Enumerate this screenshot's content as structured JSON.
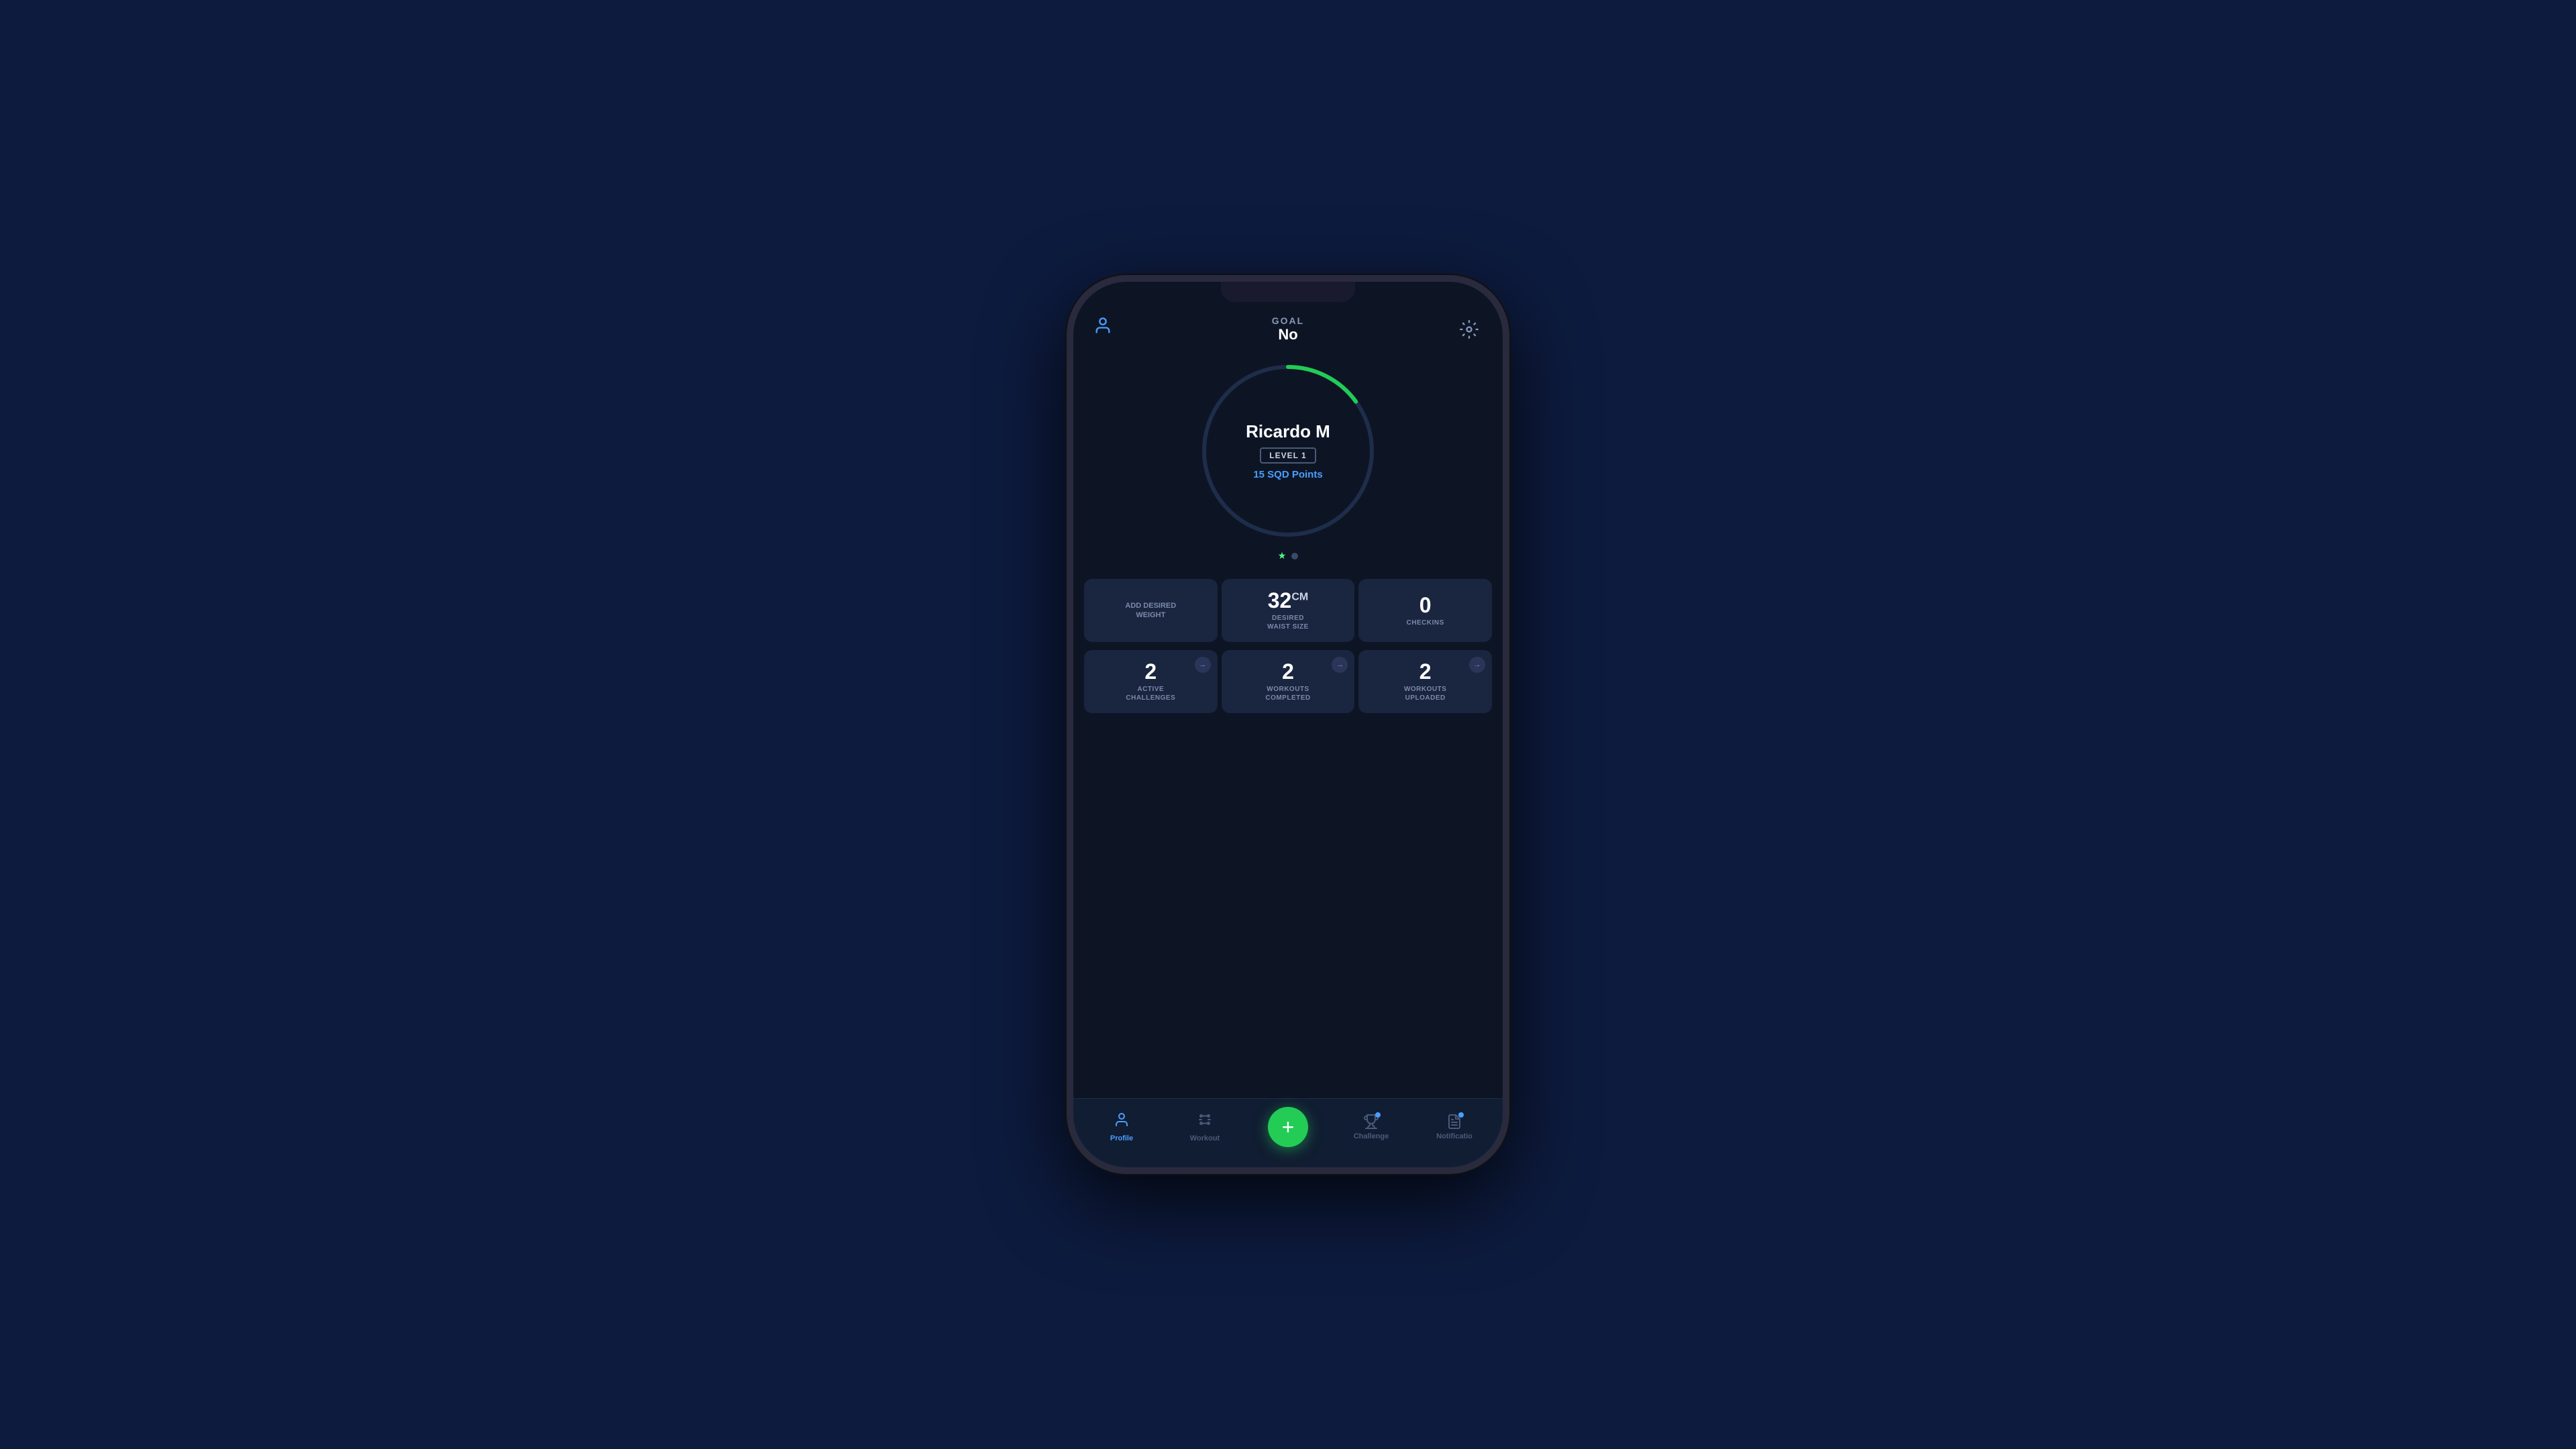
{
  "background": "#0d1b3e",
  "header": {
    "goal_label": "GOAL",
    "goal_value": "No",
    "left_icon": "user-icon",
    "right_icon": "settings-icon"
  },
  "profile": {
    "name": "Ricardo M",
    "level": "LEVEL 1",
    "points_label": "SQD Points",
    "points_value": "15",
    "circle_progress": 15
  },
  "stats_row1": [
    {
      "id": "add-weight",
      "label": "ADD DESIRED\nWEIGHT",
      "value": null,
      "has_arrow": false
    },
    {
      "id": "waist-size",
      "label": "DESIRED\nWAIST SIZE",
      "value": "32",
      "unit": "CM",
      "has_arrow": false
    },
    {
      "id": "checkins",
      "label": "CHECKINS",
      "value": "0",
      "has_arrow": false
    }
  ],
  "stats_row2": [
    {
      "id": "active-challenges",
      "label": "ACTIVE\nCHALLENGES",
      "value": "2",
      "has_arrow": true
    },
    {
      "id": "workouts-completed",
      "label": "WORKOUTS\nCOMPLETED",
      "value": "2",
      "has_arrow": true
    },
    {
      "id": "workouts-uploaded",
      "label": "WORKOUTS\nUPLOADED",
      "value": "2",
      "has_arrow": true
    }
  ],
  "nav": {
    "items": [
      {
        "id": "profile",
        "label": "Profile",
        "icon": "👤",
        "active": true
      },
      {
        "id": "workout",
        "label": "Workout",
        "icon": "⚡",
        "active": false
      },
      {
        "id": "add",
        "label": "",
        "icon": "+",
        "is_add": true
      },
      {
        "id": "challenge",
        "label": "Challenge",
        "icon": "🏆",
        "active": false,
        "has_dot": true
      },
      {
        "id": "notification",
        "label": "Notificatio",
        "icon": "📋",
        "active": false,
        "has_dot": true
      }
    ]
  }
}
